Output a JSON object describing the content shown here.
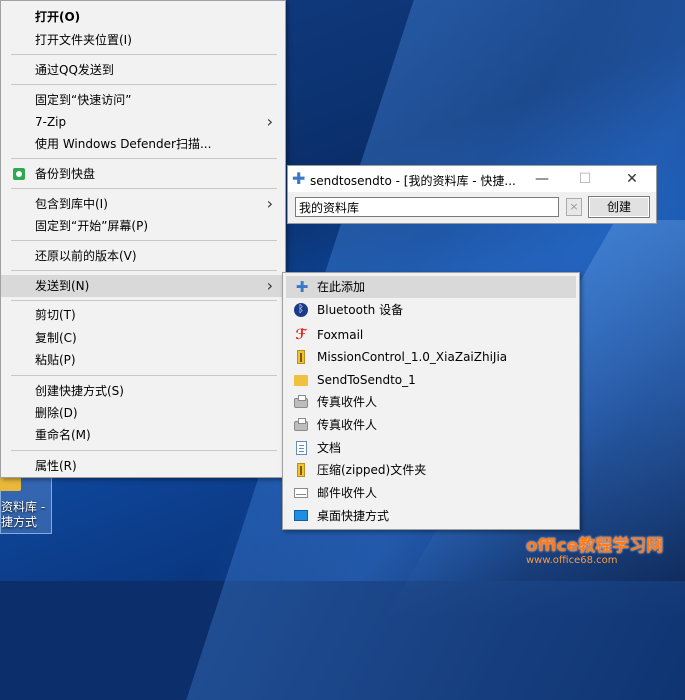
{
  "context_menu": {
    "items": [
      {
        "label": "打开(O)",
        "bold": true
      },
      {
        "label": "打开文件夹位置(I)"
      },
      {
        "label": "通过QQ发送到"
      },
      {
        "label": "固定到“快速访问”"
      },
      {
        "label": "7-Zip",
        "submenu": true
      },
      {
        "label": "使用 Windows Defender扫描..."
      },
      {
        "label": "备份到快盘",
        "icon": "kuaipan-icon"
      },
      {
        "label": "包含到库中(I)",
        "submenu": true
      },
      {
        "label": "固定到“开始”屏幕(P)"
      },
      {
        "label": "还原以前的版本(V)"
      },
      {
        "label": "发送到(N)",
        "submenu": true,
        "highlighted": true
      },
      {
        "label": "剪切(T)"
      },
      {
        "label": "复制(C)"
      },
      {
        "label": "粘贴(P)"
      },
      {
        "label": "创建快捷方式(S)"
      },
      {
        "label": "删除(D)"
      },
      {
        "label": "重命名(M)"
      },
      {
        "label": "属性(R)"
      }
    ],
    "arrow_glyph": "›"
  },
  "dialog": {
    "title": "sendtosendto - [我的资料库 - 快捷...",
    "input_value": "我的资料库",
    "clear_label": "×",
    "create_label": "创建",
    "minimize_glyph": "—",
    "maximize_glyph": "☐",
    "close_glyph": "✕",
    "title_icon_glyph": "✚"
  },
  "sendto_menu": {
    "items": [
      {
        "label": "在此添加",
        "icon": "add-icon",
        "highlighted": true
      },
      {
        "label": "Bluetooth 设备",
        "icon": "bluetooth-icon"
      },
      {
        "label": "Foxmail",
        "icon": "foxmail-icon"
      },
      {
        "label": "MissionControl_1.0_XiaZaiZhiJia",
        "icon": "zip-folder-icon"
      },
      {
        "label": "SendToSendto_1",
        "icon": "folder-icon"
      },
      {
        "label": "传真收件人",
        "icon": "fax-icon"
      },
      {
        "label": "传真收件人",
        "icon": "fax-icon"
      },
      {
        "label": "文档",
        "icon": "documents-icon"
      },
      {
        "label": "压缩(zipped)文件夹",
        "icon": "zip-folder-icon"
      },
      {
        "label": "邮件收件人",
        "icon": "mail-icon"
      },
      {
        "label": "桌面快捷方式",
        "icon": "desktop-icon"
      }
    ]
  },
  "desktop_icon": {
    "label_line1": "资料库 -",
    "label_line2": "捷方式"
  },
  "watermark": {
    "line1": "office教程学习网",
    "line2": "www.office68.com"
  }
}
